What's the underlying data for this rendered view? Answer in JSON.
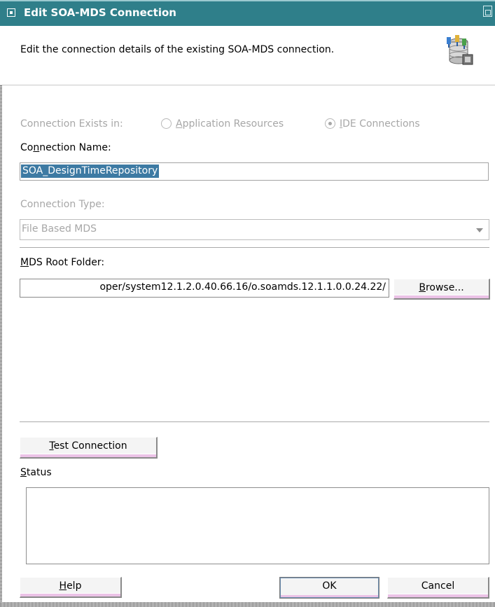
{
  "window": {
    "title": "Edit SOA-MDS Connection"
  },
  "header": {
    "description": "Edit the connection details of the existing SOA-MDS connection.",
    "icon": "database-connection-icon"
  },
  "connection_exists": {
    "label": "Connection Exists in:",
    "options": [
      {
        "label_mnemonic": "A",
        "label_rest": "pplication Resources",
        "selected": false
      },
      {
        "label_mnemonic": "I",
        "label_rest": "DE Connections",
        "selected": true
      }
    ]
  },
  "connection_name": {
    "label_pre": "Co",
    "label_mnemonic": "n",
    "label_post": "nection Name:",
    "value": "SOA_DesignTimeRepository"
  },
  "connection_type": {
    "label": "Connection Type:",
    "value": "File Based MDS"
  },
  "mds_root_folder": {
    "label_mnemonic": "M",
    "label_rest": "DS Root Folder:",
    "value": "oper/system12.1.2.0.40.66.16/o.soamds.12.1.1.0.0.24.22/",
    "browse_mnemonic": "B",
    "browse_rest": "rowse..."
  },
  "test_connection": {
    "mnemonic": "T",
    "rest": "est Connection"
  },
  "status": {
    "label_mnemonic": "S",
    "label_rest": "tatus",
    "text": ""
  },
  "buttons": {
    "help_mnemonic": "H",
    "help_rest": "elp",
    "ok": "OK",
    "cancel": "Cancel"
  },
  "colors": {
    "titlebar": "#2f7f8a",
    "selection": "#3d7aa3",
    "disabled_text": "#a7a7a7"
  }
}
